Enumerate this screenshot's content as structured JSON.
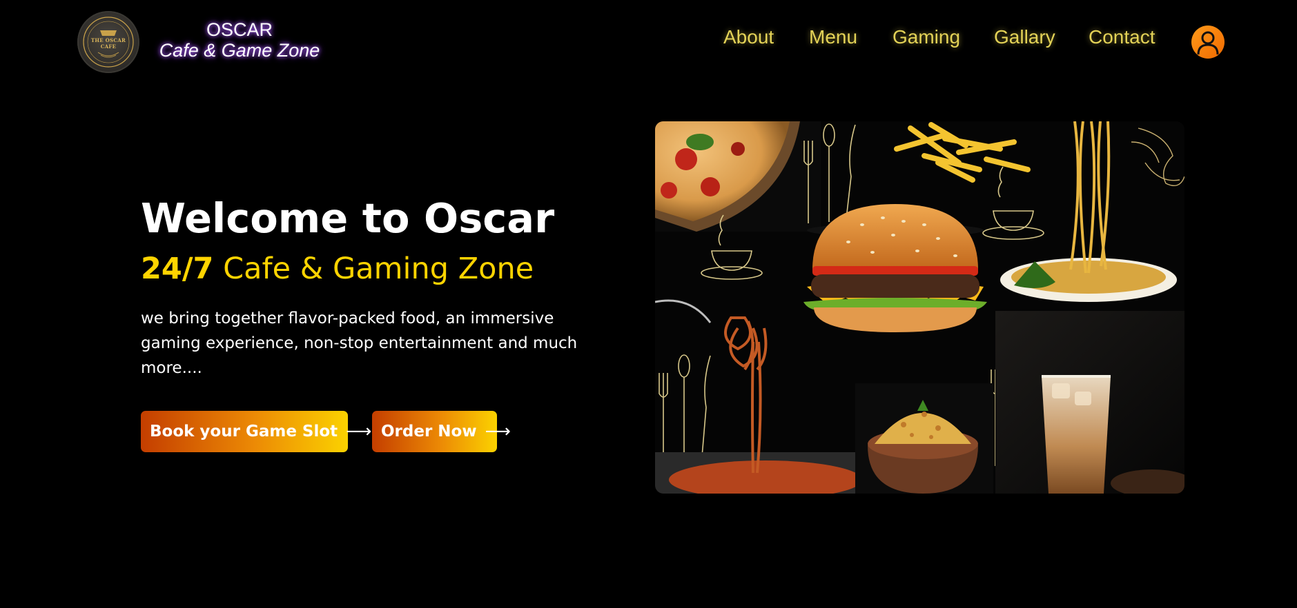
{
  "header": {
    "logo": {
      "badge_text": "THE OSCAR CAFE",
      "icon": "oscar-cafe-logo-icon"
    },
    "brand": {
      "name": "OSCAR",
      "tagline": "Cafe & Game Zone"
    },
    "nav": [
      {
        "label": "About"
      },
      {
        "label": "Menu"
      },
      {
        "label": "Gaming"
      },
      {
        "label": "Gallary"
      },
      {
        "label": "Contact"
      }
    ],
    "profile_icon": "user-icon"
  },
  "hero": {
    "title": "Welcome to Oscar",
    "subtitle_highlight": "24/7",
    "subtitle_rest": " Cafe & Gaming Zone",
    "description": "we bring together flavor-packed food, an immersive gaming experience, non-stop entertainment and much more....",
    "buttons": [
      {
        "label": "Book your Game Slot",
        "arrow": "⟶"
      },
      {
        "label": "Order Now",
        "arrow": "⟶"
      }
    ]
  },
  "collage": {
    "items": [
      "pizza",
      "fries",
      "noodles",
      "burger",
      "spaghetti",
      "biryani",
      "iced-coffee"
    ]
  },
  "colors": {
    "background": "#000000",
    "accent_yellow": "#ffd400",
    "nav_text": "#e3d257",
    "button_gradient_start": "#c43e00",
    "button_gradient_end": "#fbd200"
  }
}
